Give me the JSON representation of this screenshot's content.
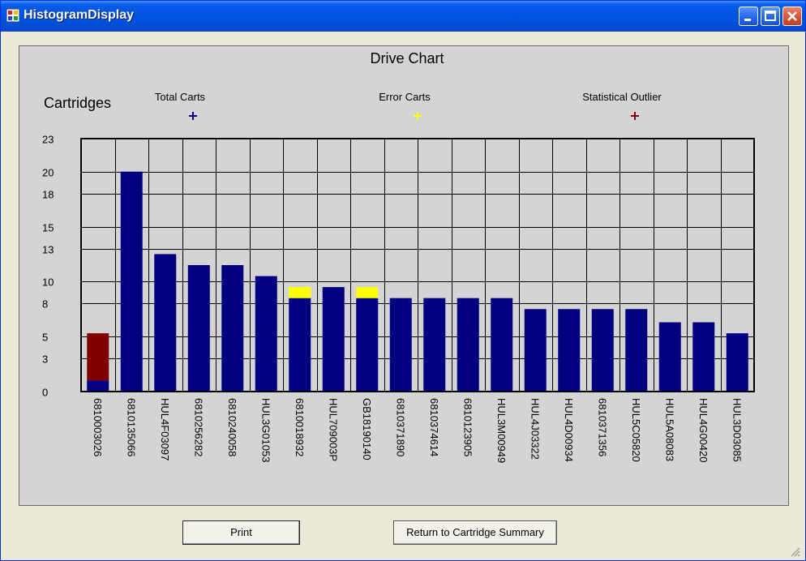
{
  "window": {
    "title": "HistogramDisplay"
  },
  "buttons": {
    "print": "Print",
    "return": "Return to Cartridge Summary"
  },
  "colors": {
    "total": "#000080",
    "error": "#ffff00",
    "outlier": "#800000"
  },
  "chart_data": {
    "type": "bar",
    "stacked": true,
    "title": "Drive Chart",
    "ylabel": "Cartridges",
    "xlabel": "",
    "ylim": [
      0,
      23
    ],
    "yticks": [
      0,
      3,
      5,
      8,
      10,
      13,
      15,
      18,
      20,
      23
    ],
    "grid": true,
    "legend_position": "top",
    "legend": [
      {
        "name": "Total Carts",
        "color": "#000080"
      },
      {
        "name": "Error Carts",
        "color": "#ffff00"
      },
      {
        "name": "Statistical Outlier",
        "color": "#800000"
      }
    ],
    "categories": [
      "6810003026",
      "6810135066",
      "HUL4F03097",
      "6810256282",
      "6810240058",
      "HUL3G01053",
      "6810018932",
      "HUL709003P",
      "GB18190140",
      "6810371890",
      "6810374614",
      "6810123905",
      "HUL3M00949",
      "HUL4J03322",
      "HUL4D00934",
      "6810371356",
      "HUL5C05820",
      "HUL5A08083",
      "HUL4G00420",
      "HUL3D03085"
    ],
    "series": [
      {
        "name": "Total Carts",
        "values": [
          1,
          20,
          12.5,
          11.5,
          11.5,
          10.5,
          8.5,
          9.5,
          8.5,
          8.5,
          8.5,
          8.5,
          8.5,
          7.5,
          7.5,
          7.5,
          7.5,
          6.3,
          6.3,
          5.3
        ]
      },
      {
        "name": "Error Carts",
        "values": [
          0,
          0,
          0,
          0,
          0,
          0,
          1,
          0,
          1,
          0,
          0,
          0,
          0,
          0,
          0,
          0,
          0,
          0,
          0,
          0
        ]
      },
      {
        "name": "Statistical Outlier",
        "values": [
          4.3,
          0,
          0,
          0,
          0,
          0,
          0,
          0,
          0,
          0,
          0,
          0,
          0,
          0,
          0,
          0,
          0,
          0,
          0,
          0
        ]
      }
    ]
  }
}
